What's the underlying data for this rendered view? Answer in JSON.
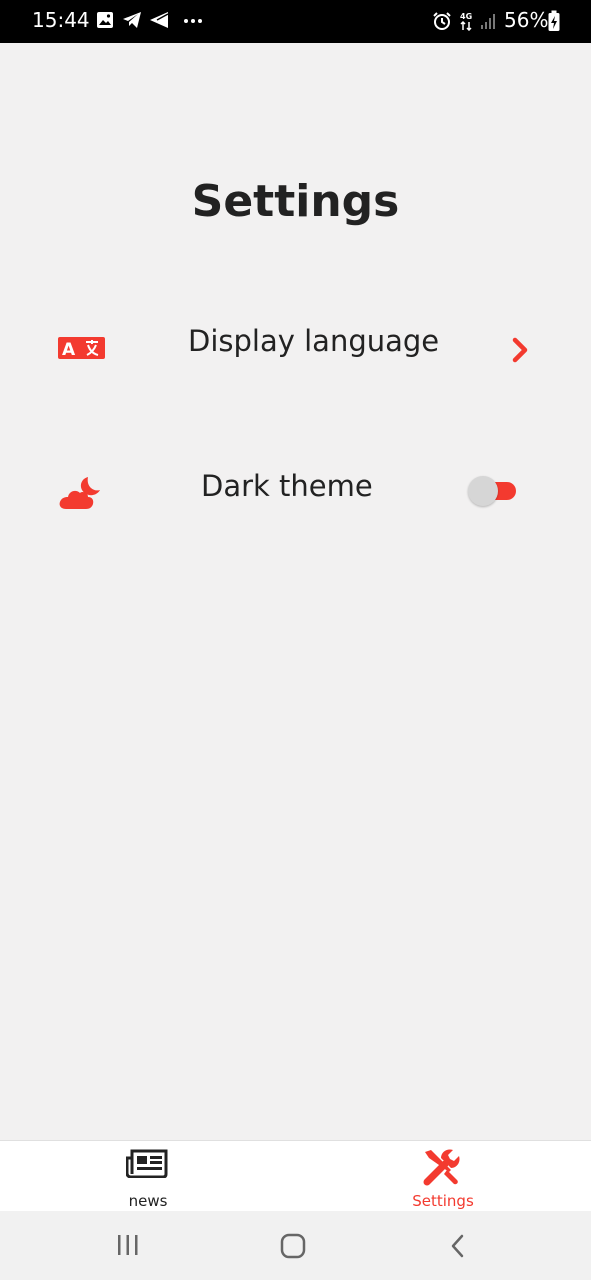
{
  "status_bar": {
    "time": "15:44",
    "battery": "56%",
    "left_icons": [
      "gallery-icon",
      "telegram-icon",
      "send-icon",
      "more-dots-icon"
    ],
    "right_icons": [
      "alarm-icon",
      "network-4g-icon",
      "signal-icon",
      "battery-icon"
    ]
  },
  "page": {
    "title": "Settings"
  },
  "settings": {
    "display_language": {
      "label": "Display language",
      "icon": "translate-icon"
    },
    "dark_theme": {
      "label": "Dark theme",
      "icon": "cloud-moon-icon",
      "enabled": false
    }
  },
  "bottom_nav": {
    "items": [
      {
        "label": "news",
        "icon": "newspaper-icon",
        "active": false
      },
      {
        "label": "Settings",
        "icon": "tools-icon",
        "active": true
      }
    ]
  },
  "colors": {
    "accent": "#f33a2f",
    "background": "#f2f1f1",
    "text": "#222222"
  }
}
